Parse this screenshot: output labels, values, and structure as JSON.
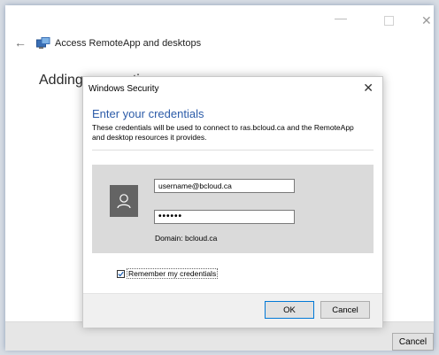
{
  "window": {
    "app_title": "Access RemoteApp and desktops",
    "heading": "Adding connection",
    "cancel_label": "Cancel"
  },
  "dialog": {
    "title": "Windows Security",
    "heading": "Enter your credentials",
    "description": "These credentials will be used to connect to ras.bcloud.ca and the RemoteApp and desktop resources it provides.",
    "username_value": "username@bcloud.ca",
    "password_value": "••••••",
    "domain_text": "Domain: bcloud.ca",
    "remember_label": "Remember my credentials",
    "remember_checked": true,
    "ok_label": "OK",
    "cancel_label": "Cancel"
  },
  "icons": {
    "back": "back-arrow-icon",
    "app": "remote-desktop-icon",
    "avatar": "user-avatar-icon",
    "close": "close-icon",
    "check": "checkmark-icon"
  },
  "colors": {
    "heading_blue": "#2b5ba8",
    "avatar_bg": "#646464",
    "ok_border": "#0078d7"
  }
}
